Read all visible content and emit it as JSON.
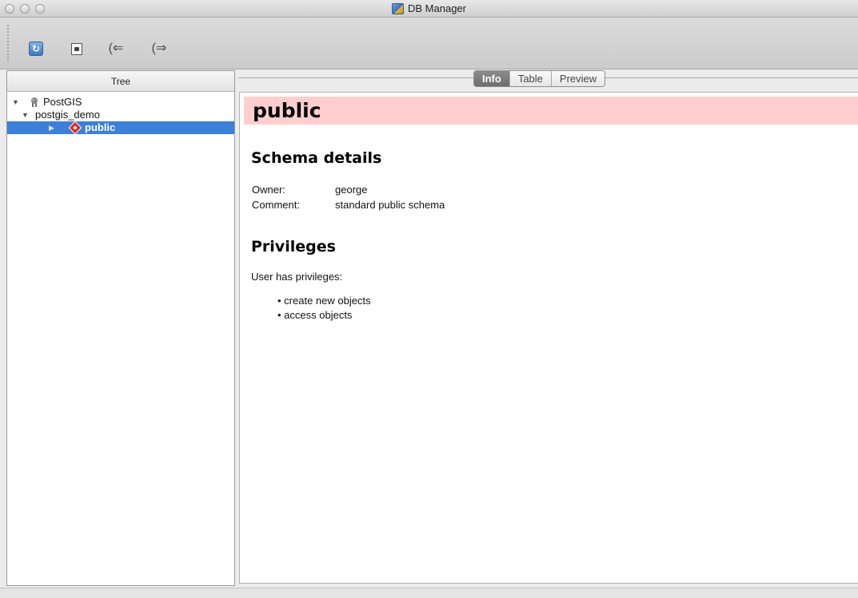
{
  "window": {
    "title": "DB Manager"
  },
  "toolbar": {
    "buttons": [
      {
        "name": "refresh",
        "icon": "refresh-icon"
      },
      {
        "name": "sql-window",
        "icon": "sql-window-icon"
      },
      {
        "name": "import-layer",
        "icon": "import-icon"
      },
      {
        "name": "export-layer",
        "icon": "export-icon"
      }
    ]
  },
  "tree": {
    "header": "Tree",
    "items": [
      {
        "label": "PostGIS",
        "level": 0,
        "expanded": true
      },
      {
        "label": "postgis_demo",
        "level": 1,
        "expanded": true
      },
      {
        "label": "public",
        "level": 2,
        "expanded": false,
        "selected": true
      }
    ]
  },
  "tabs": [
    {
      "label": "Info",
      "active": true
    },
    {
      "label": "Table",
      "active": false
    },
    {
      "label": "Preview",
      "active": false
    }
  ],
  "info": {
    "title": "public",
    "schema_details_heading": "Schema details",
    "owner_label": "Owner:",
    "owner_value": "george",
    "comment_label": "Comment:",
    "comment_value": "standard public schema",
    "privileges_heading": "Privileges",
    "privileges_intro": "User has privileges:",
    "privileges": [
      "create new objects",
      "access objects"
    ]
  },
  "colors": {
    "selection": "#3d7fd9",
    "title_band": "#ffcfcf"
  }
}
